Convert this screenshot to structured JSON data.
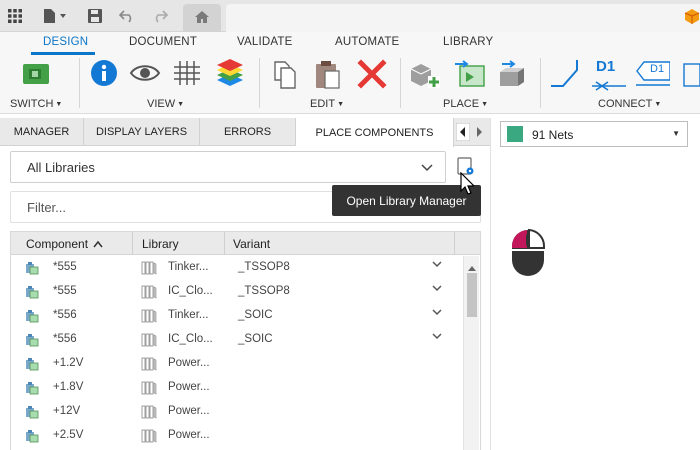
{
  "ribbon": {
    "tabs": [
      "DESIGN",
      "DOCUMENT",
      "VALIDATE",
      "AUTOMATE",
      "LIBRARY"
    ],
    "groups": [
      "SWITCH",
      "VIEW",
      "EDIT",
      "PLACE",
      "CONNECT"
    ],
    "connect_labels": [
      "D1",
      "D1"
    ]
  },
  "panel": {
    "tabs": [
      "MANAGER",
      "DISPLAY LAYERS",
      "ERRORS",
      "PLACE COMPONENTS"
    ],
    "library_select": "All Libraries",
    "filter_placeholder": "Filter...",
    "tooltip": "Open Library Manager"
  },
  "table": {
    "headers": [
      "Component",
      "Library",
      "Variant"
    ],
    "rows": [
      {
        "component": "*555",
        "library": "Tinker...",
        "variant": "_TSSOP8"
      },
      {
        "component": "*555",
        "library": "IC_Clo...",
        "variant": "_TSSOP8"
      },
      {
        "component": "*556",
        "library": "Tinker...",
        "variant": "_SOIC"
      },
      {
        "component": "*556",
        "library": "IC_Clo...",
        "variant": "_SOIC"
      },
      {
        "component": "+1.2V",
        "library": "Power...",
        "variant": ""
      },
      {
        "component": "+1.8V",
        "library": "Power...",
        "variant": ""
      },
      {
        "component": "+12V",
        "library": "Power...",
        "variant": ""
      },
      {
        "component": "+2.5V",
        "library": "Power...",
        "variant": ""
      }
    ]
  },
  "nets": {
    "label": "91 Nets",
    "swatch_color": "#3aa981"
  },
  "colors": {
    "accent": "#0b76c7",
    "mouse_left": "#c2185b"
  }
}
